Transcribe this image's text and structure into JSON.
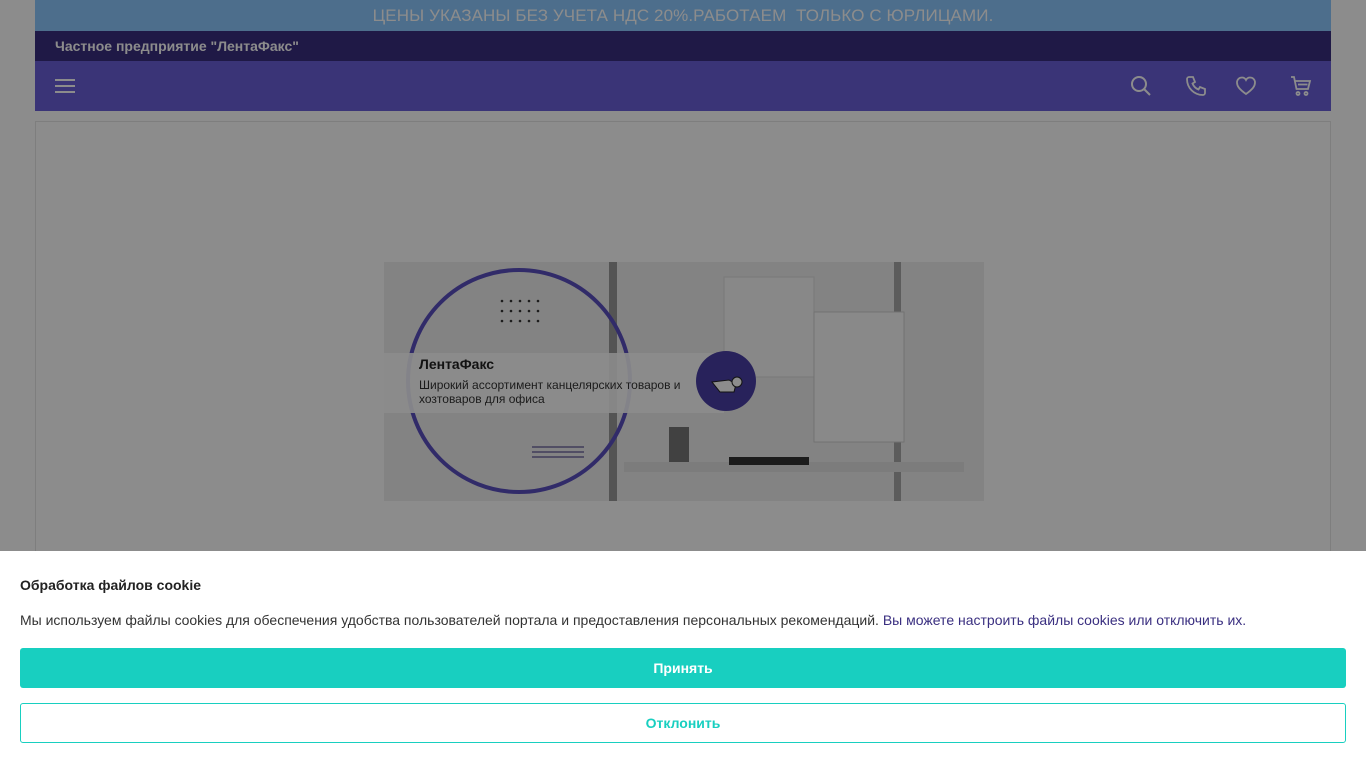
{
  "notice": {
    "text": "ЦЕНЫ УКАЗАНЫ БЕЗ УЧЕТА НДС 20%.РАБОТАЕМ  ТОЛЬКО С ЮРЛИЦАМИ."
  },
  "company": {
    "name": "Частное предприятие \"ЛентаФакс\""
  },
  "nav": {
    "icons": [
      "menu-icon",
      "search-icon",
      "phone-icon",
      "heart-icon",
      "cart-icon"
    ]
  },
  "banner": {
    "brand": "ЛентаФакс",
    "tagline": "Широкий ассортимент канцелярских товаров и хозтоваров для офиса"
  },
  "cookie": {
    "title": "Обработка файлов cookie",
    "text": "Мы используем файлы cookies для обеспечения удобства пользователей портала и предоставления персональных рекомендаций.",
    "link": "Вы можете настроить файлы cookies или отключить их.",
    "accept": "Принять",
    "decline": "Отклонить"
  },
  "colors": {
    "accent": "#18cfc0",
    "brand_dark": "#3a2f80",
    "brand_nav": "#6a5fd9",
    "notice_bg": "#8cc8ff"
  }
}
